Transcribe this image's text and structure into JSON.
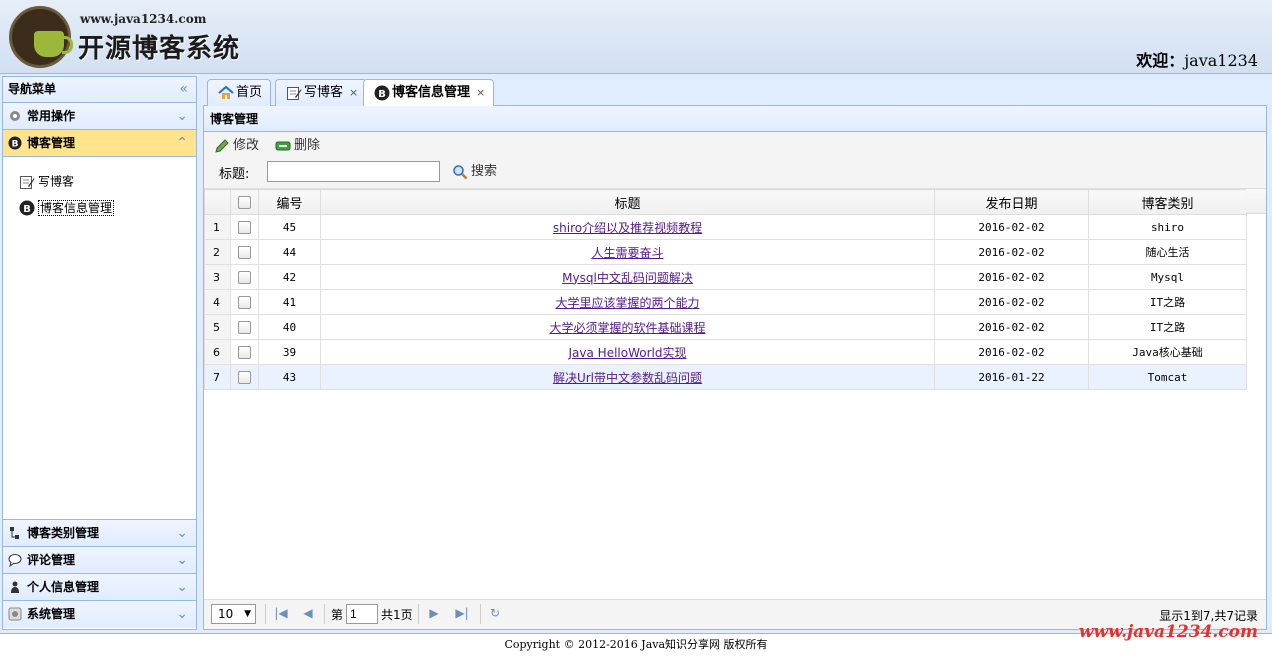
{
  "header": {
    "logo_url": "www.java1234.com",
    "logo_title": "开源博客系统",
    "welcome_prefix": "欢迎：",
    "username": "java1234"
  },
  "nav": {
    "title": "导航菜单",
    "sections": {
      "common": "常用操作",
      "blog": "博客管理",
      "blogtype": "博客类别管理",
      "comment": "评论管理",
      "personal": "个人信息管理",
      "system": "系统管理"
    },
    "items": {
      "write": "写博客",
      "manage": "博客信息管理"
    }
  },
  "tabs": [
    {
      "label": "首页"
    },
    {
      "label": "写博客"
    },
    {
      "label": "博客信息管理"
    }
  ],
  "panel": {
    "title": "博客管理",
    "edit_label": "修改",
    "delete_label": "删除",
    "search_label": "标题:",
    "search_value": "",
    "search_button": "搜索"
  },
  "grid": {
    "columns": [
      "编号",
      "标题",
      "发布日期",
      "博客类别"
    ],
    "rows": [
      {
        "num": "1",
        "id": "45",
        "title": "shiro介绍以及推荐视频教程",
        "date": "2016-02-02",
        "type": "shiro"
      },
      {
        "num": "2",
        "id": "44",
        "title": "人生需要奋斗",
        "date": "2016-02-02",
        "type": "随心生活"
      },
      {
        "num": "3",
        "id": "42",
        "title": "Mysql中文乱码问题解决",
        "date": "2016-02-02",
        "type": "Mysql"
      },
      {
        "num": "4",
        "id": "41",
        "title": "大学里应该掌握的两个能力",
        "date": "2016-02-02",
        "type": "IT之路"
      },
      {
        "num": "5",
        "id": "40",
        "title": "大学必须掌握的软件基础课程",
        "date": "2016-02-02",
        "type": "IT之路"
      },
      {
        "num": "6",
        "id": "39",
        "title": "Java HelloWorld实现",
        "date": "2016-02-02",
        "type": "Java核心基础"
      },
      {
        "num": "7",
        "id": "43",
        "title": "解决Url带中文参数乱码问题",
        "date": "2016-01-22",
        "type": "Tomcat"
      }
    ]
  },
  "pager": {
    "page_size": "10",
    "page_prefix": "第",
    "page_value": "1",
    "page_total": "共1页",
    "info": "显示1到7,共7记录"
  },
  "footer": {
    "copyright": "Copyright © 2012-2016 Java知识分享网 版权所有",
    "watermark": "www.java1234.com"
  },
  "colors": {
    "border": "#95B8E7",
    "header_bg": "#E0ECFF",
    "active_section": "#FFE48D",
    "link": "#551A8B",
    "watermark": "#E8302A"
  }
}
